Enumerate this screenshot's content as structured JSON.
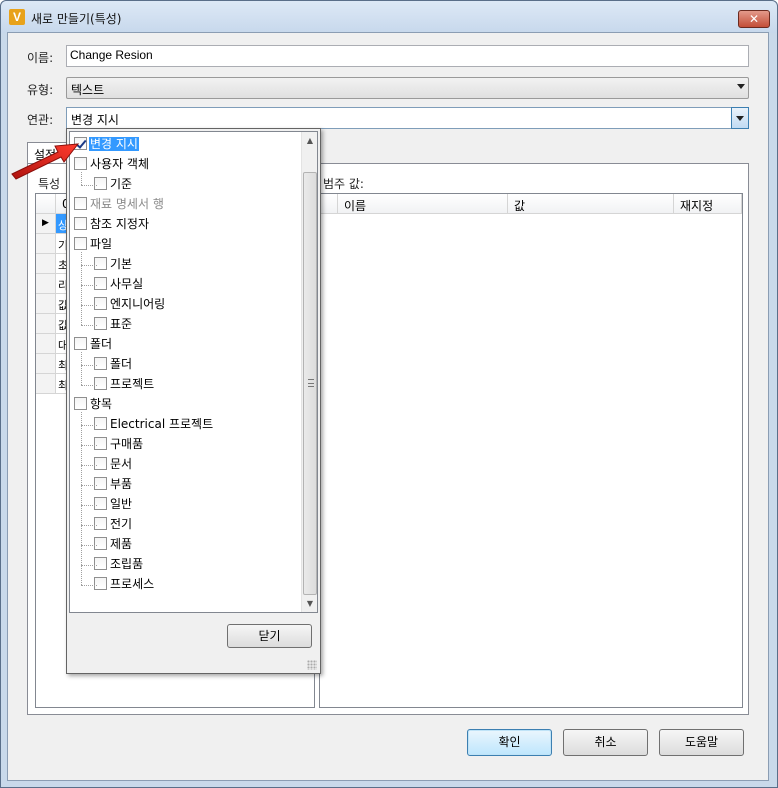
{
  "window": {
    "title": "새로 만들기(특성)",
    "close_glyph": "✕",
    "app_icon_letter": "V"
  },
  "form": {
    "name_label": "이름:",
    "name_value": "Change Resion",
    "type_label": "유형:",
    "type_value": "텍스트",
    "relation_label": "연관:",
    "relation_value": "변경 지시"
  },
  "tab": {
    "label": "설정"
  },
  "left_grid": {
    "section_label": "특성",
    "header_col": "0",
    "rows": [
      {
        "marker": "▶",
        "text": "상"
      },
      {
        "marker": "",
        "text": "기"
      },
      {
        "marker": "",
        "text": "초"
      },
      {
        "marker": "",
        "text": "리"
      },
      {
        "marker": "",
        "text": "값"
      },
      {
        "marker": "",
        "text": "값"
      },
      {
        "marker": "",
        "text": "대"
      },
      {
        "marker": "",
        "text": "최"
      },
      {
        "marker": "",
        "text": "최"
      }
    ]
  },
  "right_grid": {
    "section_label": "범주 값:",
    "columns": [
      "이름",
      "값",
      "재지정"
    ]
  },
  "popup": {
    "close_button": "닫기",
    "tree": [
      {
        "label": "변경 지시",
        "checked": true,
        "selected": true
      },
      {
        "label": "사용자 객체",
        "checked": false
      },
      {
        "label": "기준",
        "checked": false
      },
      {
        "label": "재료 명세서 행",
        "checked": false,
        "disabled": true
      },
      {
        "label": "참조 지정자",
        "checked": false
      },
      {
        "label": "파일",
        "checked": false
      },
      {
        "label": "기본",
        "checked": false
      },
      {
        "label": "사무실",
        "checked": false
      },
      {
        "label": "엔지니어링",
        "checked": false
      },
      {
        "label": "표준",
        "checked": false
      },
      {
        "label": "폴더",
        "checked": false
      },
      {
        "label": "폴더",
        "checked": false
      },
      {
        "label": "프로젝트",
        "checked": false
      },
      {
        "label": "항목",
        "checked": false
      },
      {
        "label": "Electrical 프로젝트",
        "checked": false
      },
      {
        "label": "구매품",
        "checked": false
      },
      {
        "label": "문서",
        "checked": false
      },
      {
        "label": "부품",
        "checked": false
      },
      {
        "label": "일반",
        "checked": false
      },
      {
        "label": "전기",
        "checked": false
      },
      {
        "label": "제품",
        "checked": false
      },
      {
        "label": "조립품",
        "checked": false
      },
      {
        "label": "프로세스",
        "checked": false
      }
    ],
    "scroll_up": "▲",
    "scroll_down": "▼"
  },
  "buttons": {
    "ok": "확인",
    "cancel": "취소",
    "help": "도움말"
  },
  "colors": {
    "selection": "#3399ff",
    "annotation_arrow": "#e0201b"
  }
}
